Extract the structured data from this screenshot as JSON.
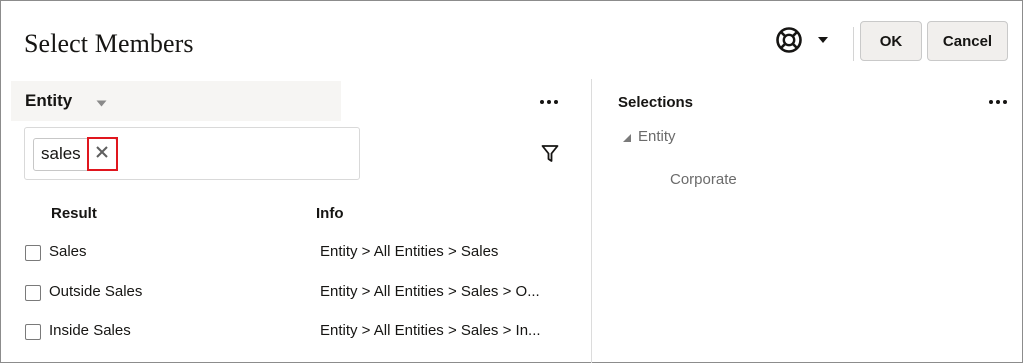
{
  "dialog": {
    "title": "Select Members",
    "help_icon": "lifebuoy-help-icon",
    "ok_label": "OK",
    "cancel_label": "Cancel"
  },
  "left_panel": {
    "dimension_label": "Entity",
    "search": {
      "chip_text": "sales",
      "remove_icon": "close-icon"
    },
    "filter_icon": "filter-icon",
    "more_icon": "more-icon",
    "columns": {
      "result": "Result",
      "info": "Info"
    },
    "rows": [
      {
        "label": "Sales",
        "info": "Entity > All Entities > Sales"
      },
      {
        "label": "Outside Sales",
        "info": "Entity > All Entities > Sales > O..."
      },
      {
        "label": "Inside Sales",
        "info": "Entity > All Entities > Sales > In..."
      }
    ]
  },
  "right_panel": {
    "title": "Selections",
    "more_icon": "more-icon",
    "tree": {
      "root": "Entity",
      "children": [
        "Corporate"
      ]
    }
  },
  "colors": {
    "highlight_red": "#e0161e",
    "button_bg": "#f1efed",
    "header_bg": "#f6f5f3",
    "muted_text": "#6b6b6b"
  }
}
